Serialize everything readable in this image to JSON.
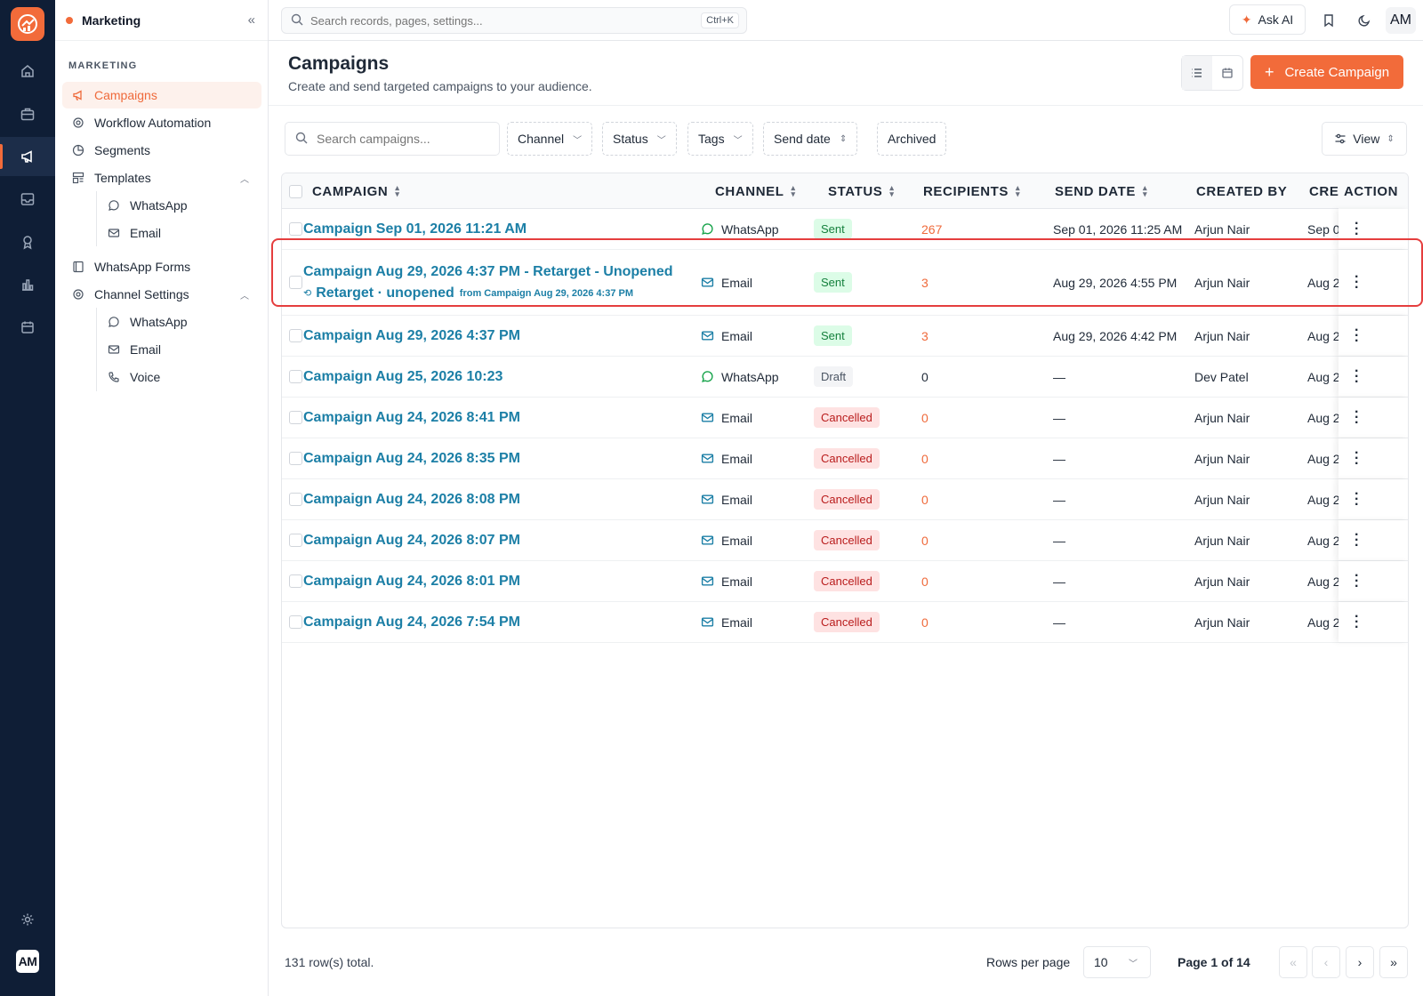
{
  "brand": {
    "accent": "#f26b3a",
    "link": "#1c7fa6",
    "rail_bg": "#0f1e36"
  },
  "rail": {
    "items": [
      "home-icon",
      "briefcase-icon",
      "megaphone-icon",
      "inbox-icon",
      "award-icon",
      "bar-chart-icon",
      "calendar-icon"
    ],
    "settings_icon": "gear-icon",
    "avatar": "AM"
  },
  "sidebar": {
    "title": "Marketing",
    "section": "MARKETING",
    "items": [
      {
        "label": "Campaigns",
        "icon": "megaphone-icon"
      },
      {
        "label": "Workflow Automation",
        "icon": "workflow-icon"
      },
      {
        "label": "Segments",
        "icon": "pie-chart-icon"
      },
      {
        "label": "Templates",
        "icon": "template-icon"
      },
      {
        "label": "WhatsApp Forms",
        "icon": "form-icon"
      },
      {
        "label": "Channel Settings",
        "icon": "settings-icon"
      }
    ],
    "templates_sub": [
      {
        "label": "WhatsApp",
        "icon": "whatsapp-icon"
      },
      {
        "label": "Email",
        "icon": "mail-icon"
      }
    ],
    "channel_sub": [
      {
        "label": "WhatsApp",
        "icon": "whatsapp-icon"
      },
      {
        "label": "Email",
        "icon": "mail-icon"
      },
      {
        "label": "Voice",
        "icon": "phone-icon"
      }
    ]
  },
  "topbar": {
    "search_placeholder": "Search records, pages, settings...",
    "shortcut": "Ctrl+K",
    "ask_ai": "Ask AI",
    "avatar": "AM"
  },
  "page": {
    "title": "Campaigns",
    "subtitle": "Create and send targeted campaigns to your audience.",
    "create_button": "Create Campaign"
  },
  "filters": {
    "search_placeholder": "Search campaigns...",
    "channel": "Channel",
    "status": "Status",
    "tags": "Tags",
    "send_date": "Send date",
    "archived": "Archived",
    "view": "View"
  },
  "table": {
    "columns": [
      "CAMPAIGN",
      "CHANNEL",
      "STATUS",
      "RECIPIENTS",
      "SEND DATE",
      "CREATED BY",
      "CRE",
      "ACTION"
    ],
    "rows": [
      {
        "name": "Campaign Sep 01, 2026 11:21 AM",
        "channel": "WhatsApp",
        "status": "Sent",
        "recipients": "267",
        "send_date": "Sep 01, 2026 11:25 AM",
        "created_by": "Arjun Nair",
        "created": "Sep 0"
      },
      {
        "name": "Campaign Aug 29, 2026 4:37 PM - Retarget - Unopened",
        "retarget": "Retarget · unopened",
        "retarget_from": "from Campaign Aug 29, 2026 4:37 PM",
        "channel": "Email",
        "status": "Sent",
        "recipients": "3",
        "send_date": "Aug 29, 2026 4:55 PM",
        "created_by": "Arjun Nair",
        "created": "Aug 2"
      },
      {
        "name": "Campaign Aug 29, 2026 4:37 PM",
        "channel": "Email",
        "status": "Sent",
        "recipients": "3",
        "send_date": "Aug 29, 2026 4:42 PM",
        "created_by": "Arjun Nair",
        "created": "Aug 2"
      },
      {
        "name": "Campaign Aug 25, 2026 10:23",
        "channel": "WhatsApp",
        "status": "Draft",
        "recipients": "0",
        "send_date": "—",
        "created_by": "Dev Patel",
        "created": "Aug 2"
      },
      {
        "name": "Campaign Aug 24, 2026 8:41 PM",
        "channel": "Email",
        "status": "Cancelled",
        "recipients": "0",
        "send_date": "—",
        "created_by": "Arjun Nair",
        "created": "Aug 2"
      },
      {
        "name": "Campaign Aug 24, 2026 8:35 PM",
        "channel": "Email",
        "status": "Cancelled",
        "recipients": "0",
        "send_date": "—",
        "created_by": "Arjun Nair",
        "created": "Aug 2"
      },
      {
        "name": "Campaign Aug 24, 2026 8:08 PM",
        "channel": "Email",
        "status": "Cancelled",
        "recipients": "0",
        "send_date": "—",
        "created_by": "Arjun Nair",
        "created": "Aug 2"
      },
      {
        "name": "Campaign Aug 24, 2026 8:07 PM",
        "channel": "Email",
        "status": "Cancelled",
        "recipients": "0",
        "send_date": "—",
        "created_by": "Arjun Nair",
        "created": "Aug 2"
      },
      {
        "name": "Campaign Aug 24, 2026 8:01 PM",
        "channel": "Email",
        "status": "Cancelled",
        "recipients": "0",
        "send_date": "—",
        "created_by": "Arjun Nair",
        "created": "Aug 2"
      },
      {
        "name": "Campaign Aug 24, 2026 7:54 PM",
        "channel": "Email",
        "status": "Cancelled",
        "recipients": "0",
        "send_date": "—",
        "created_by": "Arjun Nair",
        "created": "Aug 2"
      }
    ]
  },
  "footer": {
    "total": "131 row(s) total.",
    "rows_per_page_label": "Rows per page",
    "rows_per_page": "10",
    "page_info": "Page 1 of 14"
  }
}
